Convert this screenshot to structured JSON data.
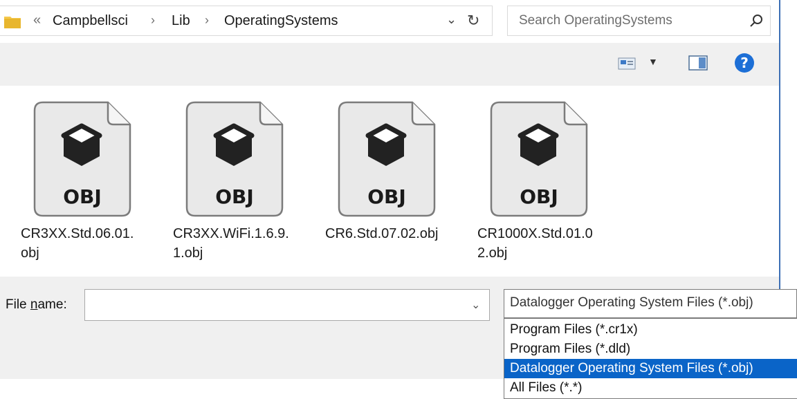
{
  "address_bar": {
    "overflow": "«",
    "crumbs": [
      "Campbellsci",
      "Lib",
      "OperatingSystems"
    ],
    "separator": "›",
    "dropdown_glyph": "⌄",
    "refresh_glyph": "↻"
  },
  "search": {
    "placeholder": "Search OperatingSystems"
  },
  "toolbar": {
    "help_label": "?"
  },
  "files": [
    {
      "name": "CR3XX.Std.06.01.obj",
      "line1": "CR3XX.Std.06.01.",
      "line2": "obj",
      "type_label": "OBJ"
    },
    {
      "name": "CR3XX.WiFi.1.6.9.1.obj",
      "line1": "CR3XX.WiFi.1.6.9.",
      "line2": "1.obj",
      "type_label": "OBJ"
    },
    {
      "name": "CR6.Std.07.02.obj",
      "line1": "CR6.Std.07.02.obj",
      "line2": "",
      "type_label": "OBJ"
    },
    {
      "name": "CR1000X.Std.01.02.obj",
      "line1": "CR1000X.Std.01.0",
      "line2": "2.obj",
      "type_label": "OBJ"
    }
  ],
  "file_name": {
    "label_prefix": "File ",
    "label_mnemonic": "n",
    "label_suffix": "ame:",
    "value": "",
    "dropdown_glyph": "⌄"
  },
  "file_type": {
    "selected": "Datalogger Operating System Files (*.obj)",
    "options": [
      "Program Files (*.cr1x)",
      "Program Files (*.dld)",
      "Datalogger Operating System Files (*.obj)",
      "All Files (*.*)"
    ],
    "selected_index": 2
  },
  "colors": {
    "accent": "#0a64c8",
    "help": "#1d6fd6",
    "toolbar_bg": "#f0f0f0"
  }
}
